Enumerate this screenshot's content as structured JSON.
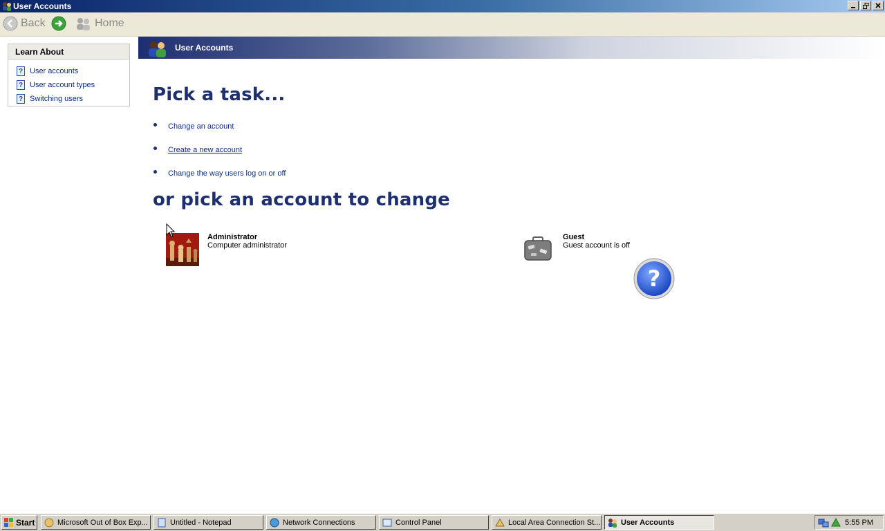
{
  "window": {
    "title": "User Accounts"
  },
  "toolbar": {
    "back_label": "Back",
    "home_label": "Home"
  },
  "learn_about": {
    "heading": "Learn About",
    "items": [
      {
        "label": "User accounts"
      },
      {
        "label": "User account types"
      },
      {
        "label": "Switching users"
      }
    ]
  },
  "header": {
    "title": "User Accounts"
  },
  "main": {
    "pick_task_heading": "Pick a task...",
    "tasks": [
      {
        "label": "Change an account"
      },
      {
        "label": "Create a new account"
      },
      {
        "label": "Change the way users log on or off"
      }
    ],
    "pick_account_heading": "or pick an account to change",
    "accounts": [
      {
        "name": "Administrator",
        "description": "Computer administrator"
      },
      {
        "name": "Guest",
        "description": "Guest account is off"
      }
    ]
  },
  "taskbar": {
    "start_label": "Start",
    "buttons": [
      {
        "label": "Microsoft Out of Box Exp..."
      },
      {
        "label": "Untitled - Notepad"
      },
      {
        "label": "Network Connections"
      },
      {
        "label": "Control Panel"
      },
      {
        "label": "Local Area Connection St..."
      },
      {
        "label": "User Accounts"
      }
    ],
    "clock": "5:55 PM"
  },
  "colors": {
    "heading_blue": "#1e2f6f",
    "link_blue": "#0a2c8c",
    "titlebar_dark": "#0a246a"
  }
}
